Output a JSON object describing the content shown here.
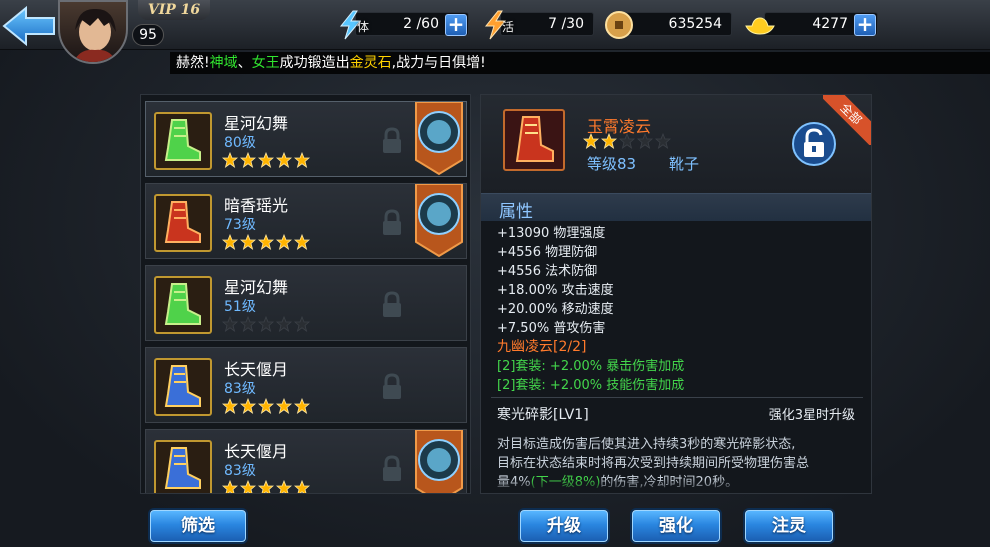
{
  "header": {
    "vip": "VIP 16",
    "player_level": "95",
    "resources": [
      {
        "id": "stamina",
        "label": "体",
        "value": "2 /60",
        "has_plus": true,
        "icon": "lightning-icon"
      },
      {
        "id": "vitality",
        "label": "活",
        "value": "7 /30",
        "has_plus": false,
        "icon": "lightning-icon"
      },
      {
        "id": "coins",
        "label": "",
        "value": "635254",
        "has_plus": false,
        "icon": "coin-icon"
      },
      {
        "id": "ingots",
        "label": "",
        "value": "4277",
        "has_plus": true,
        "icon": "gold-ingot-icon"
      }
    ]
  },
  "ticker": {
    "part1": "赫然!",
    "player1": "神域",
    "sep": "、",
    "player2": "女王",
    "part2": "成功锻造出",
    "item": "金灵石",
    "part3": ",战力与日俱增!"
  },
  "equipment_list": [
    {
      "name": "星河幻舞",
      "level": "80级",
      "stars": 5,
      "filled": 5,
      "equipped": true,
      "color": "green"
    },
    {
      "name": "暗香瑶光",
      "level": "73级",
      "stars": 5,
      "filled": 5,
      "equipped": true,
      "color": "red"
    },
    {
      "name": "星河幻舞",
      "level": "51级",
      "stars": 5,
      "filled": 0,
      "equipped": false,
      "color": "green"
    },
    {
      "name": "长天偃月",
      "level": "83级",
      "stars": 5,
      "filled": 5,
      "equipped": false,
      "color": "blue"
    },
    {
      "name": "长天偃月",
      "level": "83级",
      "stars": 5,
      "filled": 5,
      "equipped": true,
      "color": "blue"
    }
  ],
  "detail": {
    "name": "玉霄凌云",
    "stars_filled": 2,
    "stars_total": 5,
    "grade": "等级83",
    "type": "靴子",
    "corner_tag": "全部",
    "attr_header": "属性",
    "attributes": [
      "+13090 物理强度",
      "+4556 物理防御",
      "+4556 法术防御",
      "+18.00% 攻击速度",
      "+20.00% 移动速度",
      "+7.50% 普攻伤害"
    ],
    "set_title": "九幽凌云[2/2]",
    "set_bonuses": [
      "[2]套装: +2.00% 暴击伤害加成",
      "[2]套装: +2.00% 技能伤害加成"
    ],
    "skill_title": "寒光碎影[LV1]",
    "skill_hint": "强化3星时升级",
    "skill_desc_1": "对目标造成伤害后使其进入持续3秒的寒光碎影状态,",
    "skill_desc_2": "目标在状态结束时将再次受到持续期间所受物理伤害总",
    "skill_desc_3a": "量4%",
    "skill_desc_3b": "(下一级8%)",
    "skill_desc_3c": "的伤害,冷却时间20秒。"
  },
  "buttons": {
    "filter": "筛选",
    "upgrade": "升级",
    "enhance": "强化",
    "infuse": "注灵"
  },
  "colors": {
    "accent_blue": "#2a86e0",
    "orange_name": "#ff7a2c",
    "green_set": "#43d64b",
    "star_gold": "#ffb400"
  }
}
